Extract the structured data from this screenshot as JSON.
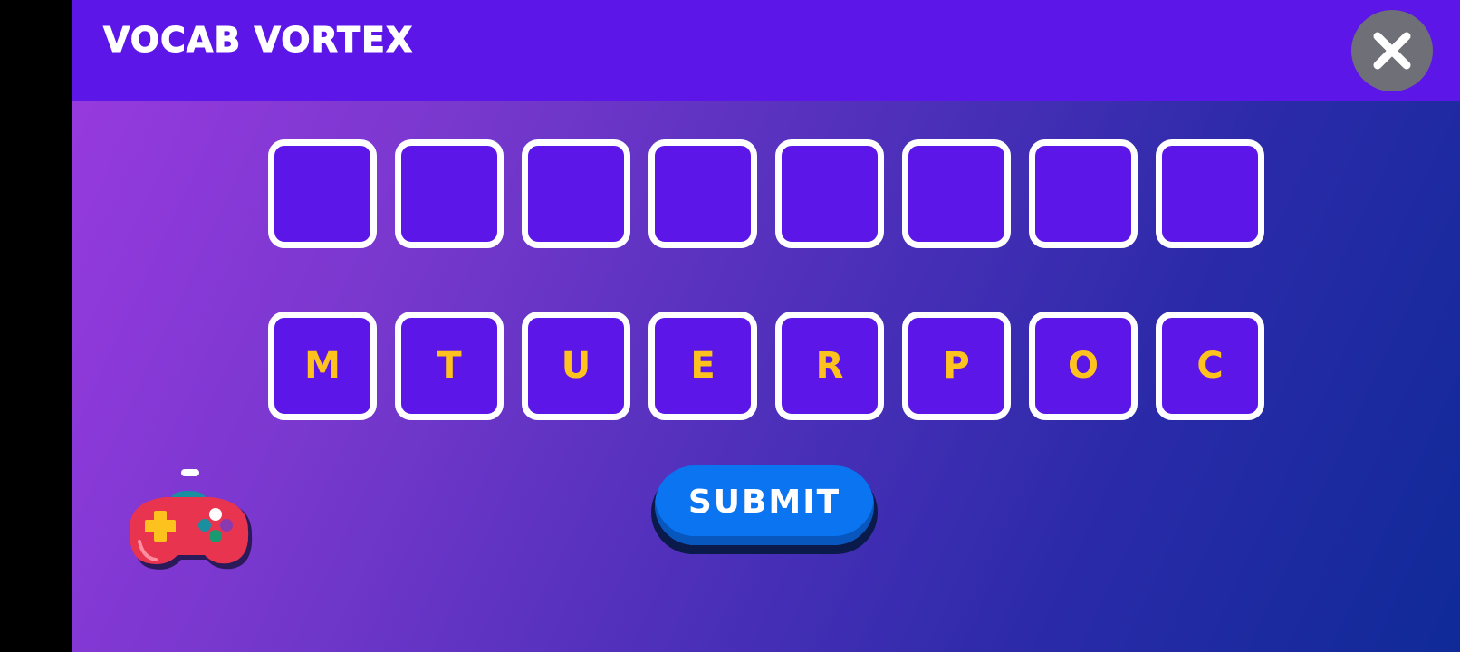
{
  "app": {
    "title": "VOCAB VORTEX"
  },
  "header": {
    "close_icon": "close-icon"
  },
  "answer_slots": [
    "",
    "",
    "",
    "",
    "",
    "",
    "",
    ""
  ],
  "letter_tiles": [
    "M",
    "T",
    "U",
    "E",
    "R",
    "P",
    "O",
    "C"
  ],
  "submit": {
    "label": "SUBMIT"
  },
  "decoration": {
    "icon": "gamepad-icon"
  },
  "colors": {
    "header": "#5c16e8",
    "tile_fill": "#5c16e8",
    "tile_border": "#ffffff",
    "letter": "#fdc21e",
    "submit": "#0b74f0",
    "close_button": "#6f6f78"
  }
}
